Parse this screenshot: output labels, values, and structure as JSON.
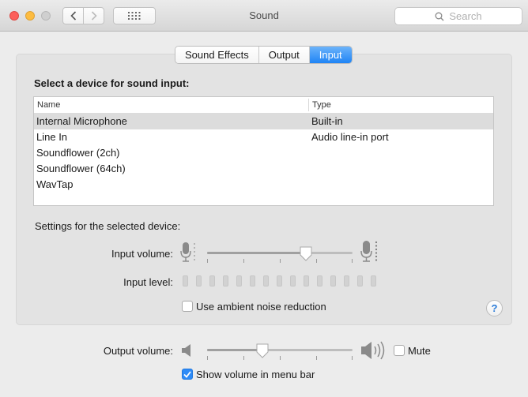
{
  "window": {
    "title": "Sound"
  },
  "toolbar": {
    "search_placeholder": "Search",
    "back_icon": "chevron-left-icon",
    "forward_icon": "chevron-right-icon",
    "grid_icon": "grid-icon"
  },
  "tabs": [
    {
      "label": "Sound Effects",
      "active": false
    },
    {
      "label": "Output",
      "active": false
    },
    {
      "label": "Input",
      "active": true
    }
  ],
  "device_list": {
    "heading": "Select a device for sound input:",
    "columns": [
      "Name",
      "Type"
    ],
    "rows": [
      {
        "name": "Internal Microphone",
        "type": "Built-in",
        "selected": true
      },
      {
        "name": "Line In",
        "type": "Audio line-in port",
        "selected": false
      },
      {
        "name": "Soundflower (2ch)",
        "type": "",
        "selected": false
      },
      {
        "name": "Soundflower (64ch)",
        "type": "",
        "selected": false
      },
      {
        "name": "WavTap",
        "type": "",
        "selected": false
      }
    ]
  },
  "settings": {
    "heading": "Settings for the selected device:",
    "input_volume_label": "Input volume:",
    "input_volume_value": 0.68,
    "input_level_label": "Input level:",
    "input_level_segments": 15,
    "input_level_active": 0,
    "ambient_noise_label": "Use ambient noise reduction",
    "ambient_noise_checked": false
  },
  "help": {
    "label": "?"
  },
  "output": {
    "volume_label": "Output volume:",
    "volume_value": 0.38,
    "mute_label": "Mute",
    "mute_checked": false,
    "show_in_menubar_label": "Show volume in menu bar",
    "show_in_menubar_checked": true
  },
  "colors": {
    "accent": "#1f84f5",
    "close": "#fc605b",
    "minimize": "#fdbc40"
  }
}
